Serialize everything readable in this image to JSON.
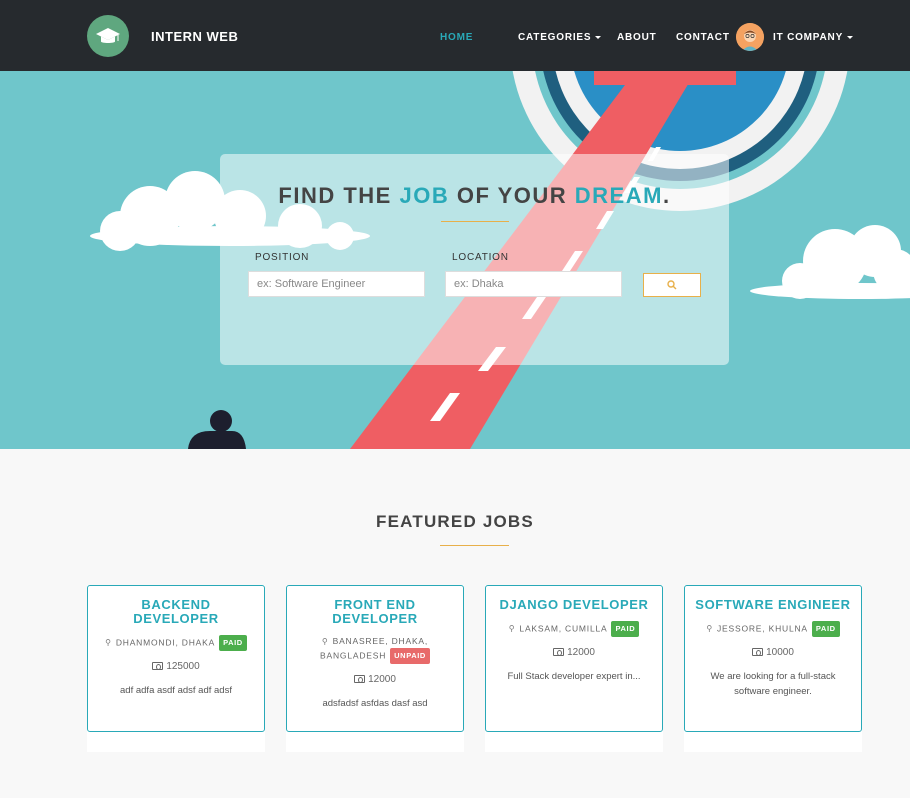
{
  "navbar": {
    "brand": "INTERN WEB",
    "links": [
      {
        "label": "HOME",
        "active": true
      },
      {
        "label": "CATEGORIES",
        "dropdown": true
      },
      {
        "label": "ABOUT"
      },
      {
        "label": "CONTACT"
      }
    ],
    "account": {
      "label": "IT COMPANY",
      "dropdown": true
    }
  },
  "hero": {
    "title": {
      "part1": "FIND THE ",
      "highlight1": "JOB",
      "part2": " OF YOUR ",
      "highlight2": "DREAM",
      "part3": "."
    },
    "position": {
      "label": "POSITION",
      "placeholder": "ex: Software Engineer"
    },
    "location": {
      "label": "LOCATION",
      "placeholder": "ex: Dhaka"
    },
    "search_icon": "search-icon"
  },
  "featured": {
    "title": "FEATURED JOBS",
    "jobs": [
      {
        "title": "BACKEND DEVELOPER",
        "location": "DHANMONDI, DHAKA",
        "badge": "PAID",
        "salary": "125000",
        "description": "adf adfa asdf adsf adf adsf"
      },
      {
        "title": "FRONT END DEVELOPER",
        "location": "BANASREE, DHAKA, BANGLADESH",
        "badge": "UNPAID",
        "salary": "12000",
        "description": "adsfadsf asfdas dasf asd"
      },
      {
        "title": "DJANGO DEVELOPER",
        "location": "LAKSAM, CUMILLA",
        "badge": "PAID",
        "salary": "12000",
        "description": "Full Stack developer expert in..."
      },
      {
        "title": "SOFTWARE ENGINEER",
        "location": "JESSORE, KHULNA",
        "badge": "PAID",
        "salary": "10000",
        "description": "We are looking for a full-stack software engineer."
      }
    ]
  },
  "colors": {
    "accent": "#29a9b8",
    "nav_bg": "#262a2e",
    "underline": "#e8b04a",
    "paid": "#4cae4c",
    "unpaid": "#e86a6a"
  }
}
